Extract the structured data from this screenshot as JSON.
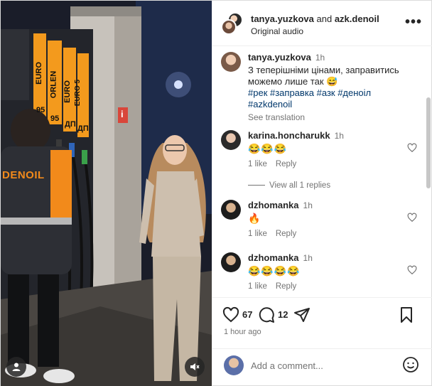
{
  "post": {
    "owner": "tanya.yuzkova",
    "and_text": "and",
    "collaborator": "azk.denoil",
    "audio": "Original audio",
    "more": "•••"
  },
  "caption": {
    "username": "tanya.yuzkova",
    "time": "1h",
    "text": "З теперішніми цінами, заправитись можемо лише так 😅",
    "hashtags": "#рек #заправка #азк #деноіл #azkdenoil",
    "see_translation": "See translation"
  },
  "comments": [
    {
      "username": "karina.honcharukk",
      "time": "1h",
      "text": "😂😂😂",
      "likes": "1 like",
      "reply": "Reply"
    },
    {
      "username": "dzhomanka",
      "time": "1h",
      "text": "🔥",
      "likes": "1 like",
      "reply": "Reply"
    },
    {
      "username": "dzhomanka",
      "time": "1h",
      "text": "😂😂😂😂",
      "likes": "1 like",
      "reply": "Reply"
    }
  ],
  "view_replies": "View all 1 replies",
  "actions": {
    "likes": "67",
    "comments": "12",
    "posted": "1 hour ago"
  },
  "add_comment": {
    "placeholder": "Add a comment..."
  },
  "media": {
    "sign_left": "DENOIL",
    "pump_labels": [
      "EURO",
      "95",
      "ORLEN",
      "95",
      "EURO",
      "ДП",
      "EURO 5",
      "ДП"
    ],
    "column_icon": "i"
  },
  "colors": {
    "link": "#00376b",
    "secondary": "#737373",
    "pump_orange": "#f39a1d"
  }
}
